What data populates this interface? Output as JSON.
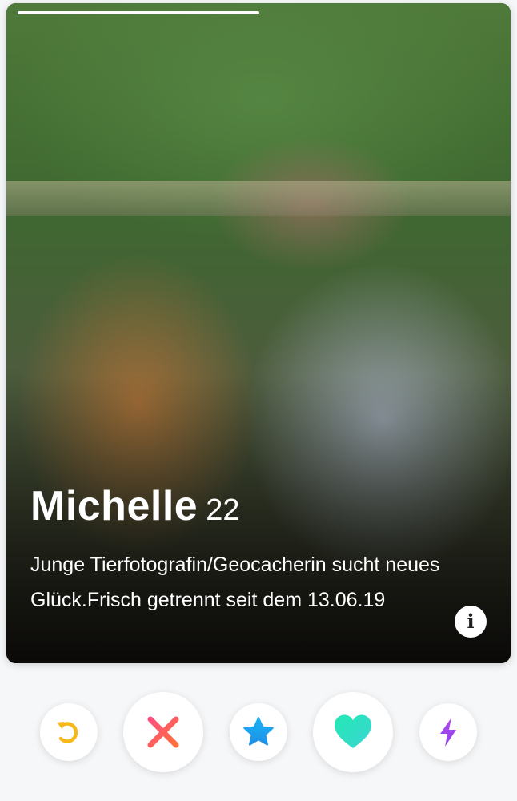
{
  "profile": {
    "name": "Michelle",
    "age": "22",
    "bio": "Junge Tierfotografin/Geocacherin sucht neues Glück.Frisch getrennt seit dem 13.06.19",
    "photo_progress": 0.5
  },
  "info_icon": "info-icon",
  "actions": [
    {
      "name": "rewind",
      "icon": "rewind-icon",
      "color": "#f5b91a"
    },
    {
      "name": "nope",
      "icon": "close-icon",
      "color": "#fd5068"
    },
    {
      "name": "super-like",
      "icon": "star-icon",
      "color": "#1eaaf1"
    },
    {
      "name": "like",
      "icon": "heart-icon",
      "color": "#2ee2c4"
    },
    {
      "name": "boost",
      "icon": "lightning-icon",
      "color": "#a64af0"
    }
  ]
}
